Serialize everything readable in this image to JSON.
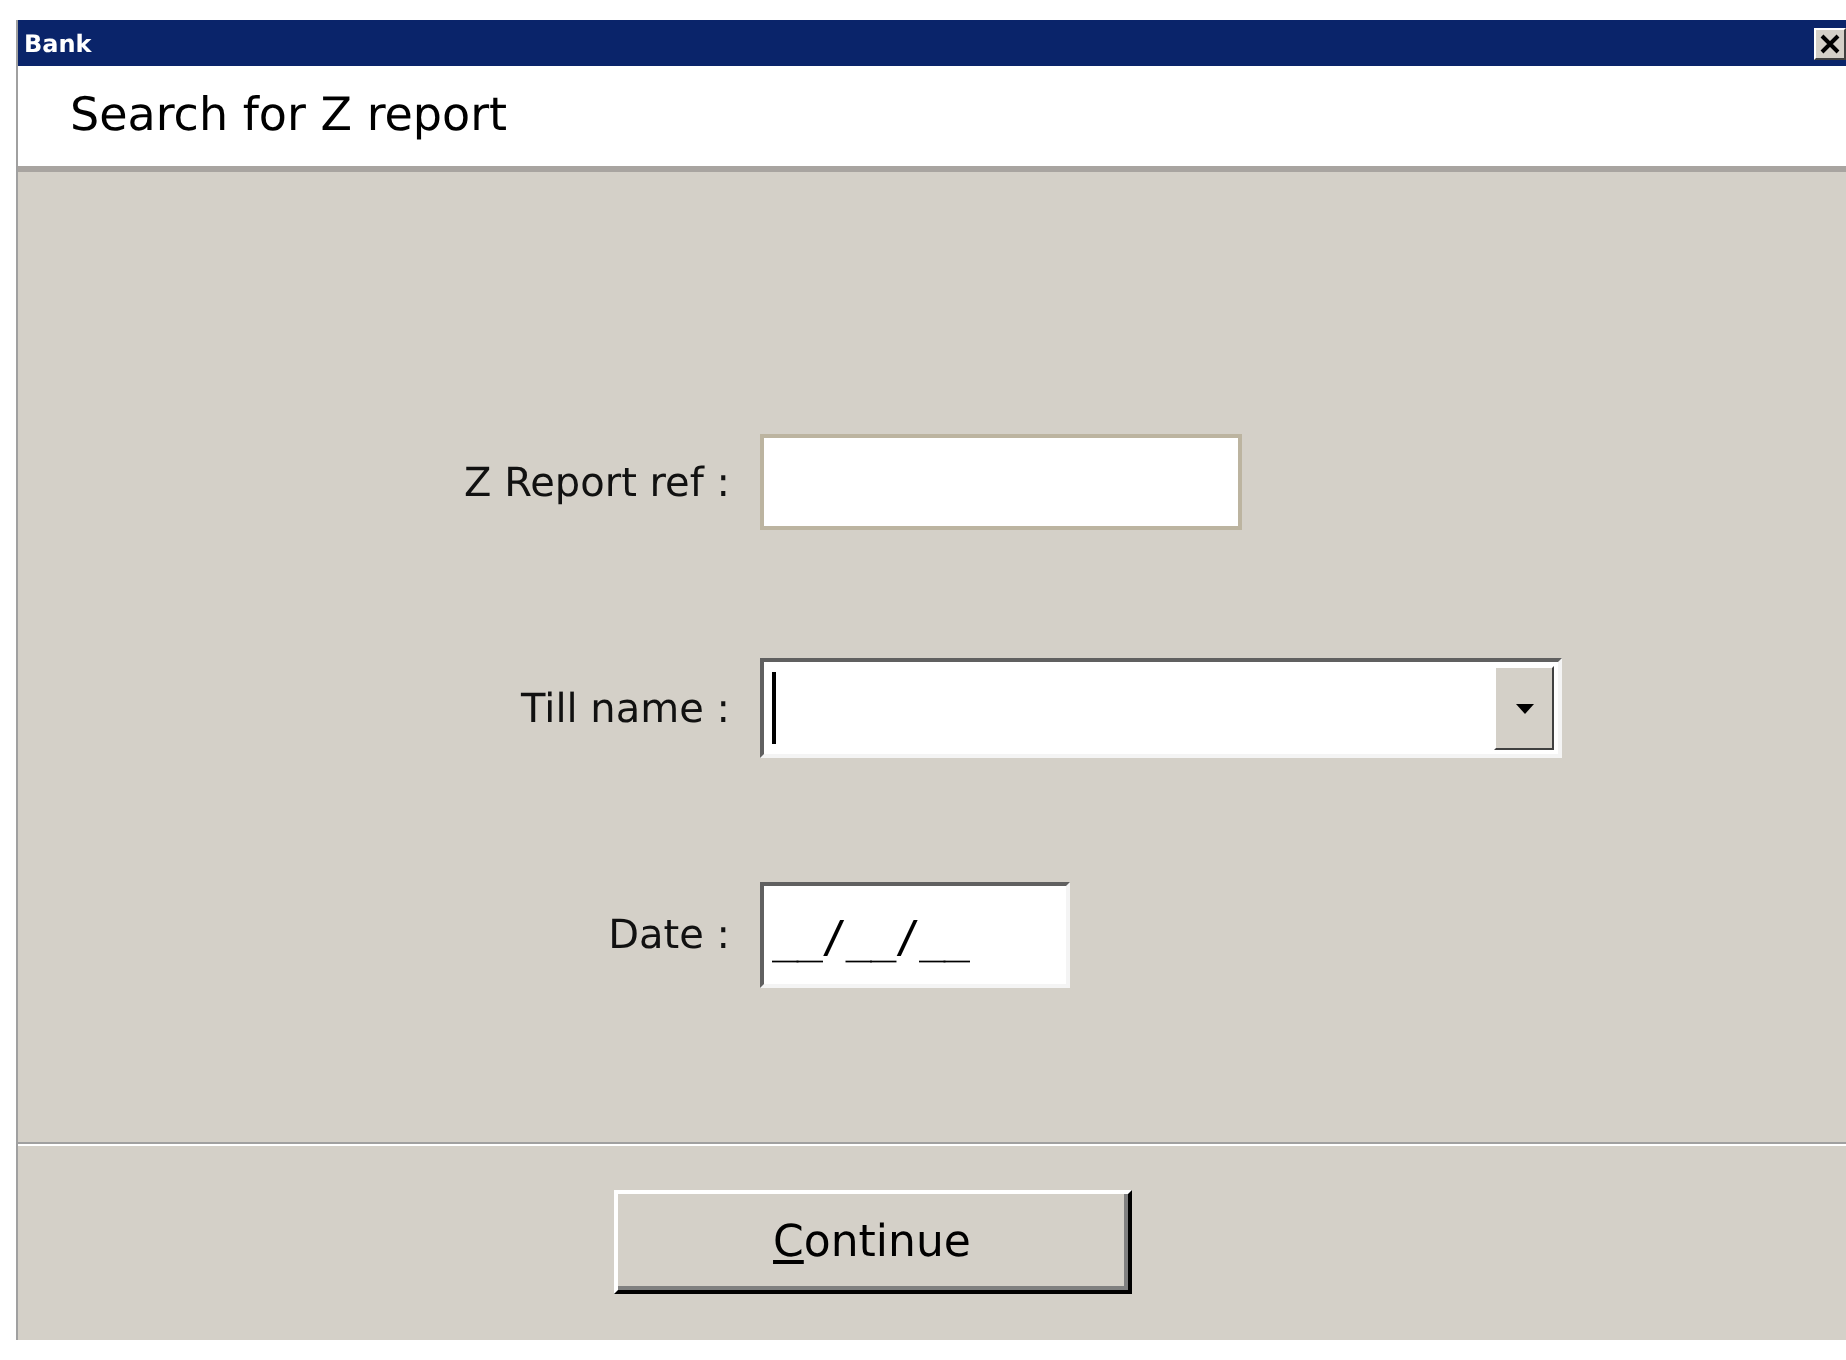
{
  "window": {
    "title": "Bank"
  },
  "header": {
    "title": "Search for Z report"
  },
  "fields": [
    {
      "kind": "text",
      "label": "Z Report ref :",
      "focused": false
    },
    {
      "kind": "combo",
      "label": "Till name :",
      "focused": true
    },
    {
      "kind": "date",
      "label": "Date :",
      "value": "__/__/__",
      "focused": false
    }
  ],
  "buttons": [
    {
      "label": "Continue",
      "first_letter_underlined": true
    }
  ]
}
